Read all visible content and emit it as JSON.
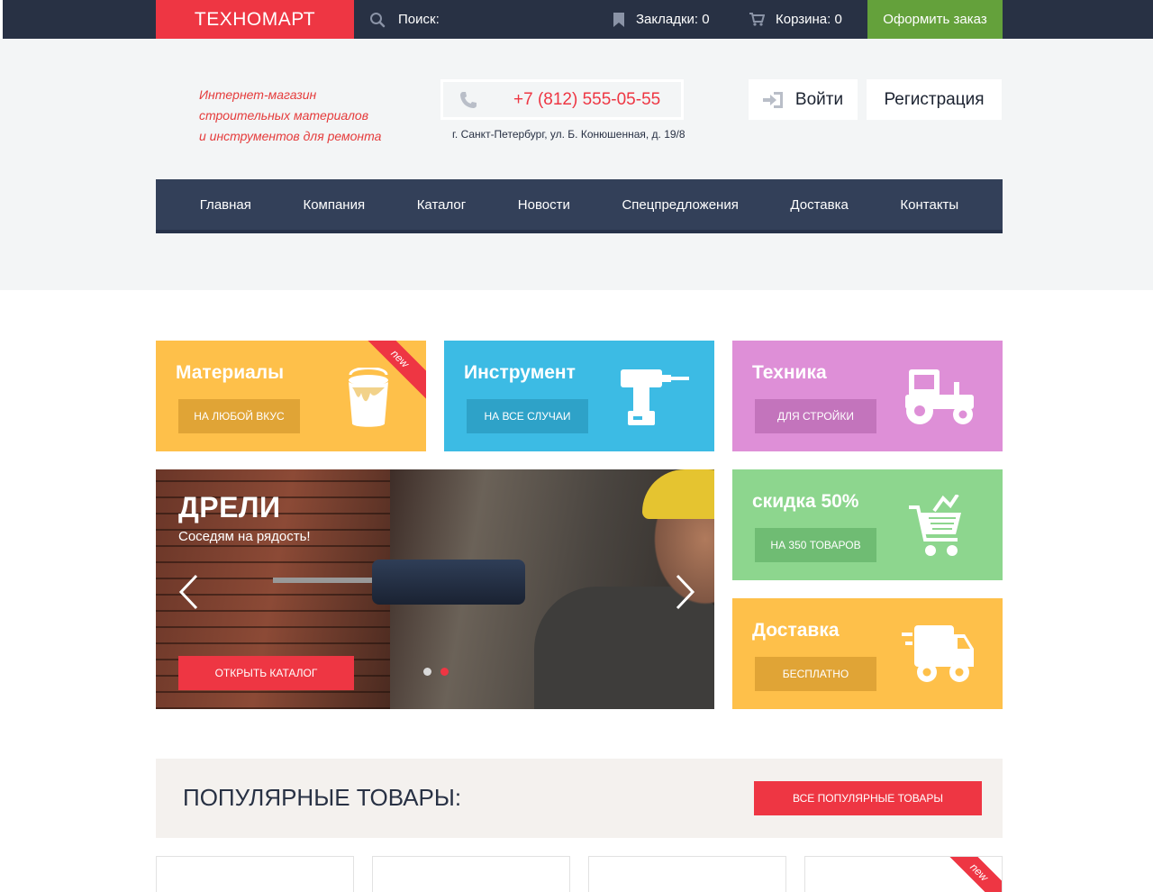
{
  "topbar": {
    "logo": "ТЕХНОМАРТ",
    "search_label": "Поиск:",
    "bookmarks_label": "Закладки: 0",
    "cart_label": "Корзина: 0",
    "order_button": "Оформить заказ"
  },
  "header": {
    "tagline": [
      "Интернет-магазин",
      "строительных материалов",
      "и инструментов для ремонта"
    ],
    "phone": "+7 (812) 555-05-55",
    "address": "г. Санкт-Петербург, ул. Б. Конюшенная, д. 19/8",
    "login": "Войти",
    "register": "Регистрация"
  },
  "nav": {
    "items": [
      "Главная",
      "Компания",
      "Каталог",
      "Новости",
      "Спецпредложения",
      "Доставка",
      "Контакты"
    ]
  },
  "tiles": {
    "materials": {
      "title": "Материалы",
      "button": "НА ЛЮБОЙ ВКУС",
      "ribbon": "new",
      "icon": "paint-bucket-icon"
    },
    "tools": {
      "title": "Инструмент",
      "button": "НА ВСЕ СЛУЧАИ",
      "icon": "drill-icon"
    },
    "machines": {
      "title": "Техника",
      "button": "ДЛЯ СТРОЙКИ",
      "icon": "tractor-icon"
    },
    "discount": {
      "title": "скидка 50%",
      "button": "НА 350 ТОВАРОВ",
      "icon": "cart-icon"
    },
    "delivery": {
      "title": "Доставка",
      "button": "БЕСПЛАТНО",
      "icon": "truck-icon"
    }
  },
  "slider": {
    "title": "ДРЕЛИ",
    "subtitle": "Соседям на рядость!",
    "button": "ОТКРЫТЬ КАТАЛОГ",
    "active_slide": 2,
    "slide_count": 2
  },
  "popular": {
    "title": "ПОПУЛЯРНЫЕ ТОВАРЫ:",
    "button": "ВСЕ ПОПУЛЯРНЫЕ ТОВАРЫ",
    "product_ribbon": "new"
  },
  "colors": {
    "accent": "#ee3643",
    "dark": "#283144",
    "green": "#64a13b",
    "yellow": "#fec04a",
    "blue": "#3cbbe4",
    "pink": "#de8fd7",
    "light_green": "#8dd68e"
  }
}
